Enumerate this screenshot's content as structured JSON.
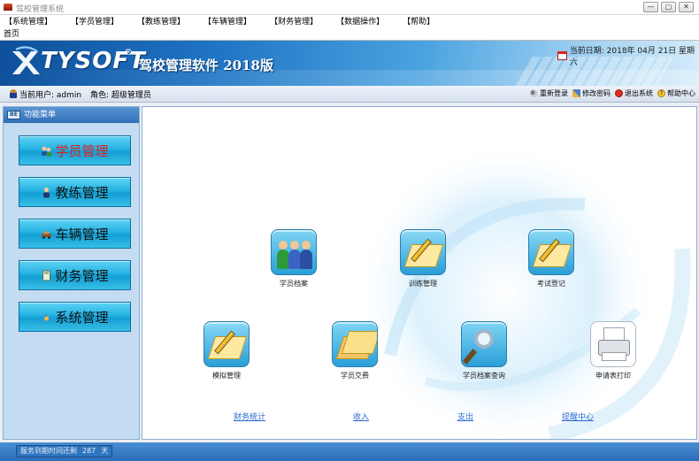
{
  "window": {
    "title": "驾校管理系统"
  },
  "menubar": {
    "items": [
      "【系统管理】",
      "【学员管理】",
      "【教练管理】",
      "【车辆管理】",
      "【财务管理】",
      "【数据操作】",
      "【帮助】"
    ]
  },
  "tabs": {
    "home": "首页"
  },
  "banner": {
    "logo": "TYSOFT",
    "reg_mark": "®",
    "product": "驾校管理软件 2018版",
    "date_label": "当前日期: 2018年 04月 21日  星期六"
  },
  "userbar": {
    "user_label": "当前用户: admin",
    "role_label": "角色: 超级管理员",
    "actions": [
      "重新登录",
      "修改密码",
      "退出系统",
      "帮助中心"
    ]
  },
  "sidebar": {
    "header": "功能菜单",
    "header_badge": "BE",
    "buttons": [
      "学员管理",
      "教练管理",
      "车辆管理",
      "财务管理",
      "系统管理"
    ]
  },
  "tiles": [
    "学员档案",
    "训练管理",
    "考试登记",
    "模拟管理",
    "学员交费",
    "学员档案查询",
    "申请表打印"
  ],
  "links": [
    "财务统计",
    "收入",
    "支出",
    "提醒中心"
  ],
  "status": {
    "label": "服务到期时间还剩",
    "days": "287",
    "unit": "天"
  },
  "colors": {
    "accent": "#25b2e3",
    "active_menu_text": "#e02020",
    "link": "#2a6ad0",
    "banner": "#1f74c3"
  }
}
